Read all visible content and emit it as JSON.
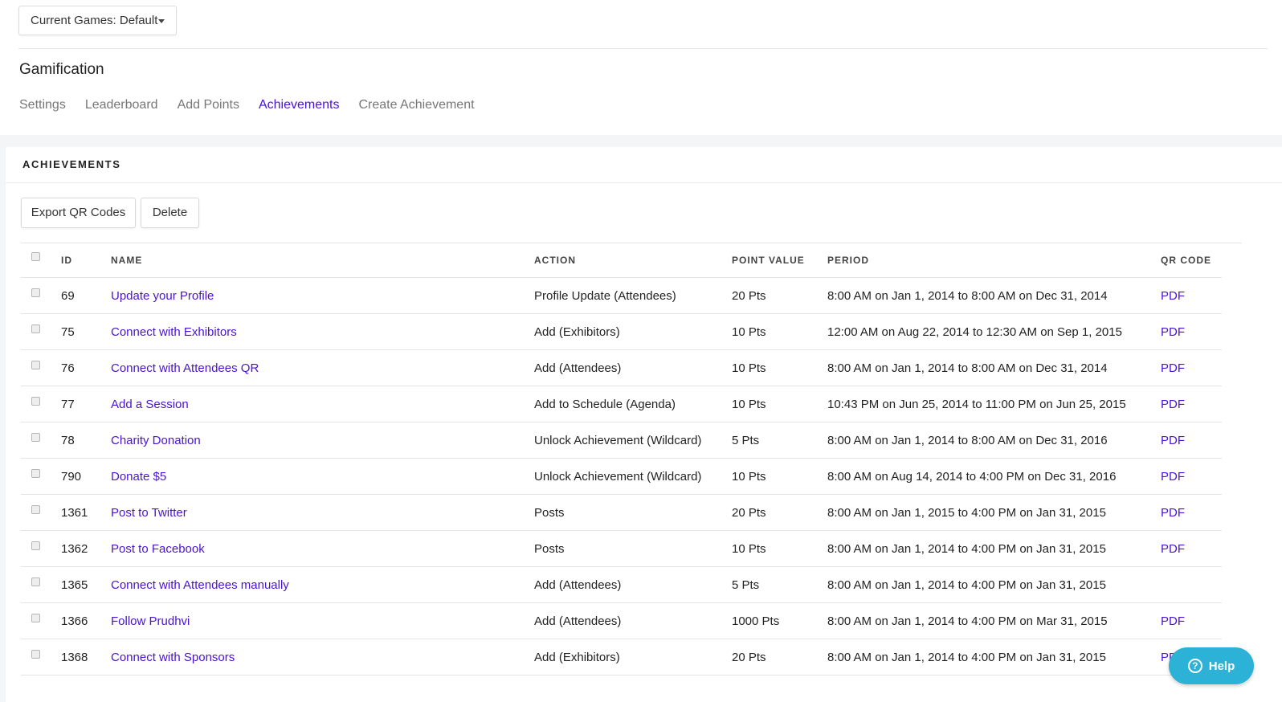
{
  "games_dropdown": {
    "label": "Current Games: Default"
  },
  "page": {
    "title": "Gamification"
  },
  "nav": [
    {
      "label": "Settings",
      "active": false
    },
    {
      "label": "Leaderboard",
      "active": false
    },
    {
      "label": "Add Points",
      "active": false
    },
    {
      "label": "Achievements",
      "active": true
    },
    {
      "label": "Create Achievement",
      "active": false
    }
  ],
  "card": {
    "title": "ACHIEVEMENTS"
  },
  "toolbar": {
    "export_label": "Export QR Codes",
    "delete_label": "Delete"
  },
  "table": {
    "headers": {
      "id": "ID",
      "name": "NAME",
      "action": "ACTION",
      "points": "POINT VALUE",
      "period": "PERIOD",
      "qr": "QR CODE"
    },
    "rows": [
      {
        "id": "69",
        "name": "Update your Profile",
        "action": "Profile Update (Attendees)",
        "points": "20 Pts",
        "period": "8:00 AM on Jan 1, 2014 to 8:00 AM on Dec 31, 2014",
        "qr": "PDF"
      },
      {
        "id": "75",
        "name": "Connect with Exhibitors",
        "action": "Add (Exhibitors)",
        "points": "10 Pts",
        "period": "12:00 AM on Aug 22, 2014 to 12:30 AM on Sep 1, 2015",
        "qr": "PDF"
      },
      {
        "id": "76",
        "name": "Connect with Attendees QR",
        "action": "Add (Attendees)",
        "points": "10 Pts",
        "period": "8:00 AM on Jan 1, 2014 to 8:00 AM on Dec 31, 2014",
        "qr": "PDF"
      },
      {
        "id": "77",
        "name": "Add a Session",
        "action": "Add to Schedule (Agenda)",
        "points": "10 Pts",
        "period": "10:43 PM on Jun 25, 2014 to 11:00 PM on Jun 25, 2015",
        "qr": "PDF"
      },
      {
        "id": "78",
        "name": "Charity Donation",
        "action": "Unlock Achievement (Wildcard)",
        "points": "5 Pts",
        "period": "8:00 AM on Jan 1, 2014 to 8:00 AM on Dec 31, 2016",
        "qr": "PDF"
      },
      {
        "id": "790",
        "name": "Donate $5",
        "action": "Unlock Achievement (Wildcard)",
        "points": "10 Pts",
        "period": "8:00 AM on Aug 14, 2014 to 4:00 PM on Dec 31, 2016",
        "qr": "PDF"
      },
      {
        "id": "1361",
        "name": "Post to Twitter",
        "action": "Posts",
        "points": "20 Pts",
        "period": "8:00 AM on Jan 1, 2015 to 4:00 PM on Jan 31, 2015",
        "qr": "PDF"
      },
      {
        "id": "1362",
        "name": "Post to Facebook",
        "action": "Posts",
        "points": "10 Pts",
        "period": "8:00 AM on Jan 1, 2014 to 4:00 PM on Jan 31, 2015",
        "qr": "PDF"
      },
      {
        "id": "1365",
        "name": "Connect with Attendees manually",
        "action": "Add (Attendees)",
        "points": "5 Pts",
        "period": "8:00 AM on Jan 1, 2014 to 4:00 PM on Jan 31, 2015",
        "qr": ""
      },
      {
        "id": "1366",
        "name": "Follow Prudhvi",
        "action": "Add (Attendees)",
        "points": "1000 Pts",
        "period": "8:00 AM on Jan 1, 2014 to 4:00 PM on Mar 31, 2015",
        "qr": "PDF"
      },
      {
        "id": "1368",
        "name": "Connect with Sponsors",
        "action": "Add (Exhibitors)",
        "points": "20 Pts",
        "period": "8:00 AM on Jan 1, 2014 to 4:00 PM on Jan 31, 2015",
        "qr": "PDF"
      }
    ]
  },
  "help": {
    "label": "Help",
    "icon": "question-circle-icon",
    "color": "#2cb2d6"
  },
  "colors": {
    "accent": "#4a12d6",
    "muted_nav": "#777777"
  }
}
